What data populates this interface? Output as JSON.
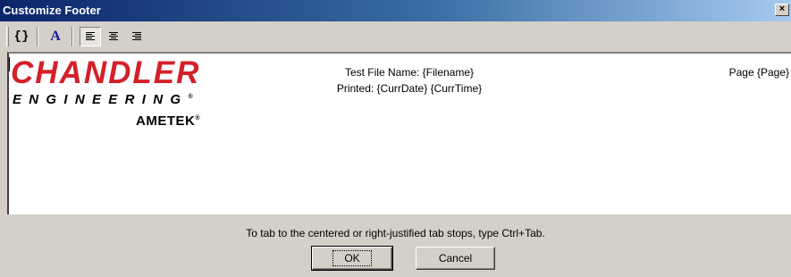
{
  "window": {
    "title": "Customize Footer",
    "close_label": "×"
  },
  "toolbar": {
    "insert_field_label": "{}",
    "font_label": "A"
  },
  "editor": {
    "logo": {
      "line1": "CHANDLER",
      "line2": "ENGINEERING",
      "line2_mark": "®",
      "line3": "AMETEK",
      "line3_mark": "®"
    },
    "center_line1": "Test File Name: {Filename}",
    "center_line2": "Printed: {CurrDate} {CurrTime}",
    "right_text": "Page {Page}"
  },
  "hint": "To tab to the centered or right-justified tab stops, type Ctrl+Tab.",
  "buttons": {
    "ok": "OK",
    "cancel": "Cancel"
  },
  "colors": {
    "title_bar": "#0a246a",
    "logo_red": "#d4202a",
    "font_icon": "#1a1aa0",
    "dialog_bg": "#d4d0c8"
  }
}
